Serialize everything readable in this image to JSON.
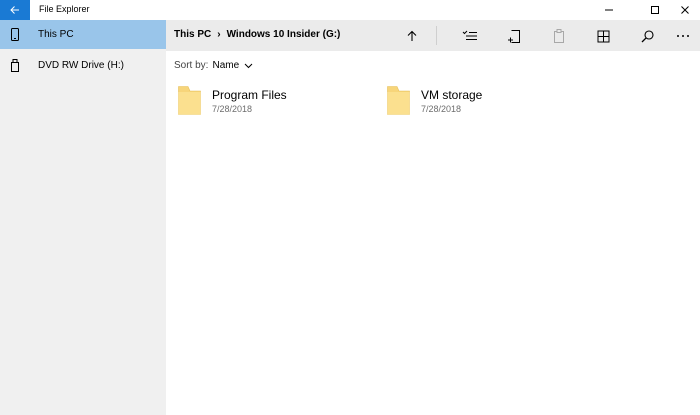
{
  "window": {
    "title": "File Explorer"
  },
  "sidebar": {
    "items": [
      {
        "label": "This PC",
        "icon": "phone-icon",
        "selected": true
      },
      {
        "label": "DVD RW Drive (H:)",
        "icon": "usb-drive-icon",
        "selected": false
      }
    ]
  },
  "breadcrumb": {
    "items": [
      "This PC",
      "Windows 10 Insider (G:)"
    ],
    "separator": "›"
  },
  "toolbar": {
    "buttons": [
      "up-arrow-icon",
      "select-icon",
      "new-folder-icon",
      "paste-icon",
      "view-icon",
      "search-icon",
      "more-icon"
    ]
  },
  "sort": {
    "label": "Sort by:",
    "value": "Name"
  },
  "folders": [
    {
      "name": "Program Files",
      "date": "7/28/2018"
    },
    {
      "name": "VM storage",
      "date": "7/28/2018"
    }
  ],
  "colors": {
    "accent": "#1a7ad4",
    "selection": "#99c5ea",
    "sidebar_bg": "#f0f0f0",
    "cmdbar_bg": "#ebebeb",
    "folder_yellow": "#f7d57a"
  }
}
